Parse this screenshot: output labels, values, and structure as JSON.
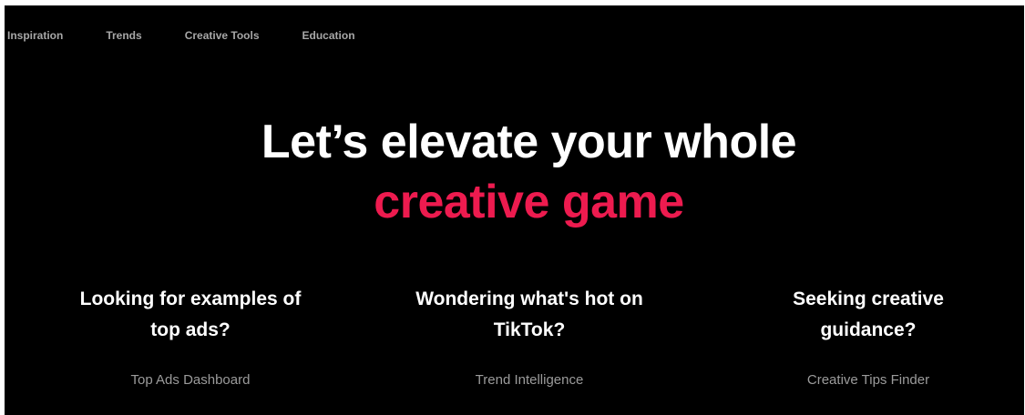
{
  "nav": {
    "items": [
      {
        "label": "Inspiration"
      },
      {
        "label": "Trends"
      },
      {
        "label": "Creative Tools"
      },
      {
        "label": "Education"
      }
    ]
  },
  "hero": {
    "line1": "Let’s elevate your whole",
    "line2": "creative game",
    "accent_color": "#ed1b4f"
  },
  "cards": [
    {
      "title_line1": "Looking for examples of",
      "title_line2": "top ads?",
      "link": "Top Ads Dashboard"
    },
    {
      "title_line1": "Wondering what's hot on",
      "title_line2": "TikTok?",
      "link": "Trend Intelligence"
    },
    {
      "title_line1": "Seeking creative",
      "title_line2": "guidance?",
      "link": "Creative Tips Finder"
    }
  ],
  "colors": {
    "background": "#000000",
    "heading": "#ffffff",
    "muted_text": "#a7a7a7"
  }
}
